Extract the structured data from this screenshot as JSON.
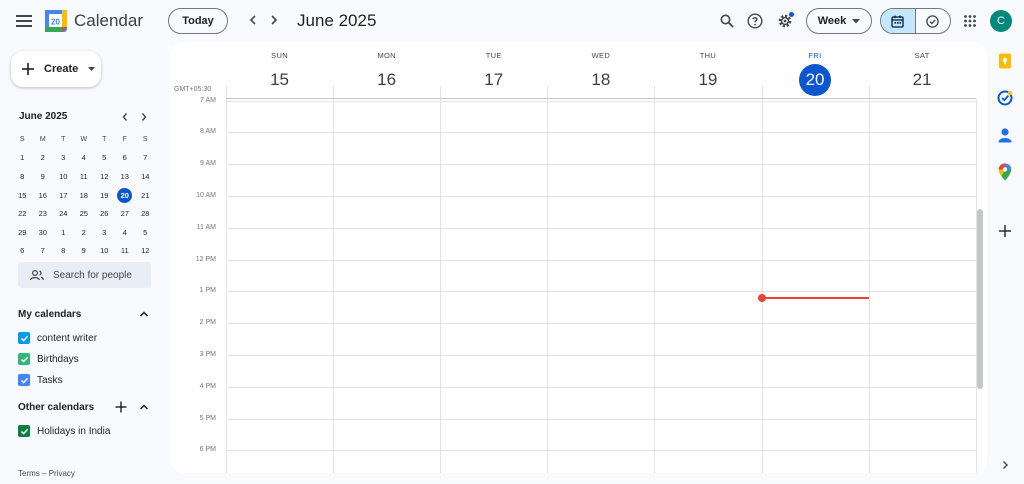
{
  "header": {
    "app_title": "Calendar",
    "logo_day": "20",
    "today_label": "Today",
    "period_title": "June 2025",
    "view_label": "Week",
    "avatar_initial": "C"
  },
  "sidebar": {
    "create_label": "Create",
    "mini_calendar": {
      "title": "June 2025",
      "weekdays": [
        "S",
        "M",
        "T",
        "W",
        "T",
        "F",
        "S"
      ],
      "weeks": [
        [
          "1",
          "2",
          "3",
          "4",
          "5",
          "6",
          "7"
        ],
        [
          "8",
          "9",
          "10",
          "11",
          "12",
          "13",
          "14"
        ],
        [
          "15",
          "16",
          "17",
          "18",
          "19",
          "20",
          "21"
        ],
        [
          "22",
          "23",
          "24",
          "25",
          "26",
          "27",
          "28"
        ],
        [
          "29",
          "30",
          "1",
          "2",
          "3",
          "4",
          "5"
        ],
        [
          "6",
          "7",
          "8",
          "9",
          "10",
          "11",
          "12"
        ]
      ],
      "selected": "20"
    },
    "search_people_placeholder": "Search for people",
    "my_calendars": {
      "title": "My calendars",
      "items": [
        {
          "label": "content writer",
          "color": "#039be5"
        },
        {
          "label": "Birthdays",
          "color": "#33b679"
        },
        {
          "label": "Tasks",
          "color": "#4285f4"
        }
      ]
    },
    "other_calendars": {
      "title": "Other calendars",
      "items": [
        {
          "label": "Holidays in India",
          "color": "#0b8043"
        }
      ]
    },
    "footer": {
      "terms": "Terms",
      "separator": "–",
      "privacy": "Privacy"
    }
  },
  "week": {
    "timezone": "GMT+05:30",
    "days": [
      {
        "name": "SUN",
        "num": "15",
        "active": false
      },
      {
        "name": "MON",
        "num": "16",
        "active": false
      },
      {
        "name": "TUE",
        "num": "17",
        "active": false
      },
      {
        "name": "WED",
        "num": "18",
        "active": false
      },
      {
        "name": "THU",
        "num": "19",
        "active": false
      },
      {
        "name": "FRI",
        "num": "20",
        "active": true
      },
      {
        "name": "SAT",
        "num": "21",
        "active": false
      }
    ],
    "hours": [
      "7 AM",
      "8 AM",
      "9 AM",
      "10 AM",
      "11 AM",
      "12 PM",
      "1 PM",
      "2 PM",
      "3 PM",
      "4 PM",
      "5 PM",
      "6 PM"
    ],
    "current_time_day": "FRI"
  },
  "colors": {
    "accent": "#0b57d0",
    "now_indicator": "#ea4335",
    "selected_toggle": "#c2e7ff"
  }
}
